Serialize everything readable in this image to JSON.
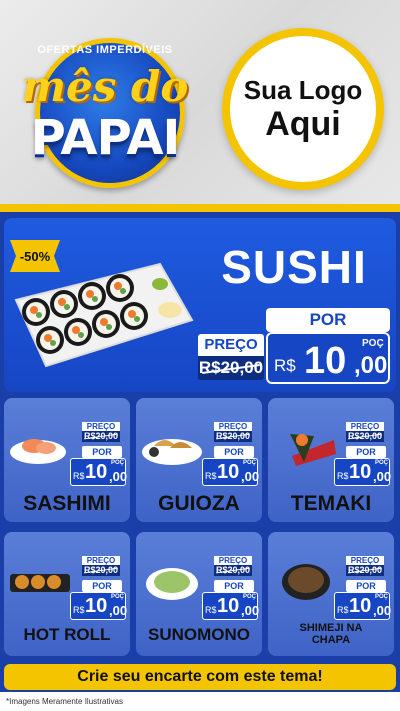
{
  "header": {
    "badge": {
      "arc_text": "OFERTAS IMPERDÍVEIS",
      "line1": "mês do",
      "line2": "PAPAI"
    },
    "logo": {
      "line1": "Sua Logo",
      "line2": "Aqui"
    }
  },
  "hero": {
    "discount": "-50%",
    "title": "SUSHI",
    "por_label": "POR",
    "preco_label": "PREÇO",
    "old_price": "R$20,00",
    "currency": "R$",
    "price_int": "10",
    "price_dec": ",00",
    "unit": "POÇ"
  },
  "cards": [
    {
      "name": "SASHIMI",
      "preco_label": "PREÇO",
      "old_price": "R$20,00",
      "por_label": "POR",
      "currency": "R$",
      "price_int": "10",
      "price_dec": ",00",
      "unit": "POÇ"
    },
    {
      "name": "GUIOZA",
      "preco_label": "PREÇO",
      "old_price": "R$20,00",
      "por_label": "POR",
      "currency": "R$",
      "price_int": "10",
      "price_dec": ",00",
      "unit": "POÇ"
    },
    {
      "name": "TEMAKI",
      "preco_label": "PREÇO",
      "old_price": "R$20,00",
      "por_label": "POR",
      "currency": "R$",
      "price_int": "10",
      "price_dec": ",00",
      "unit": "POÇ"
    },
    {
      "name": "HOT ROLL",
      "preco_label": "PREÇO",
      "old_price": "R$20,00",
      "por_label": "POR",
      "currency": "R$",
      "price_int": "10",
      "price_dec": ",00",
      "unit": "POÇ"
    },
    {
      "name": "SUNOMONO",
      "preco_label": "PREÇO",
      "old_price": "R$20,00",
      "por_label": "POR",
      "currency": "R$",
      "price_int": "10",
      "price_dec": ",00",
      "unit": "POÇ"
    },
    {
      "name": "SHIMEJI NA\nCHAPA",
      "preco_label": "PREÇO",
      "old_price": "R$20,00",
      "por_label": "POR",
      "currency": "R$",
      "price_int": "10",
      "price_dec": ",00",
      "unit": "POÇ"
    }
  ],
  "cta": "Crie seu encarte com este tema!",
  "footnote": "*Imagens Meramente Ilustrativas",
  "colors": {
    "primary_blue": "#1646c4",
    "dark_blue": "#0d2d80",
    "accent_yellow": "#f5c400",
    "card_blue": "#4a70cf"
  }
}
